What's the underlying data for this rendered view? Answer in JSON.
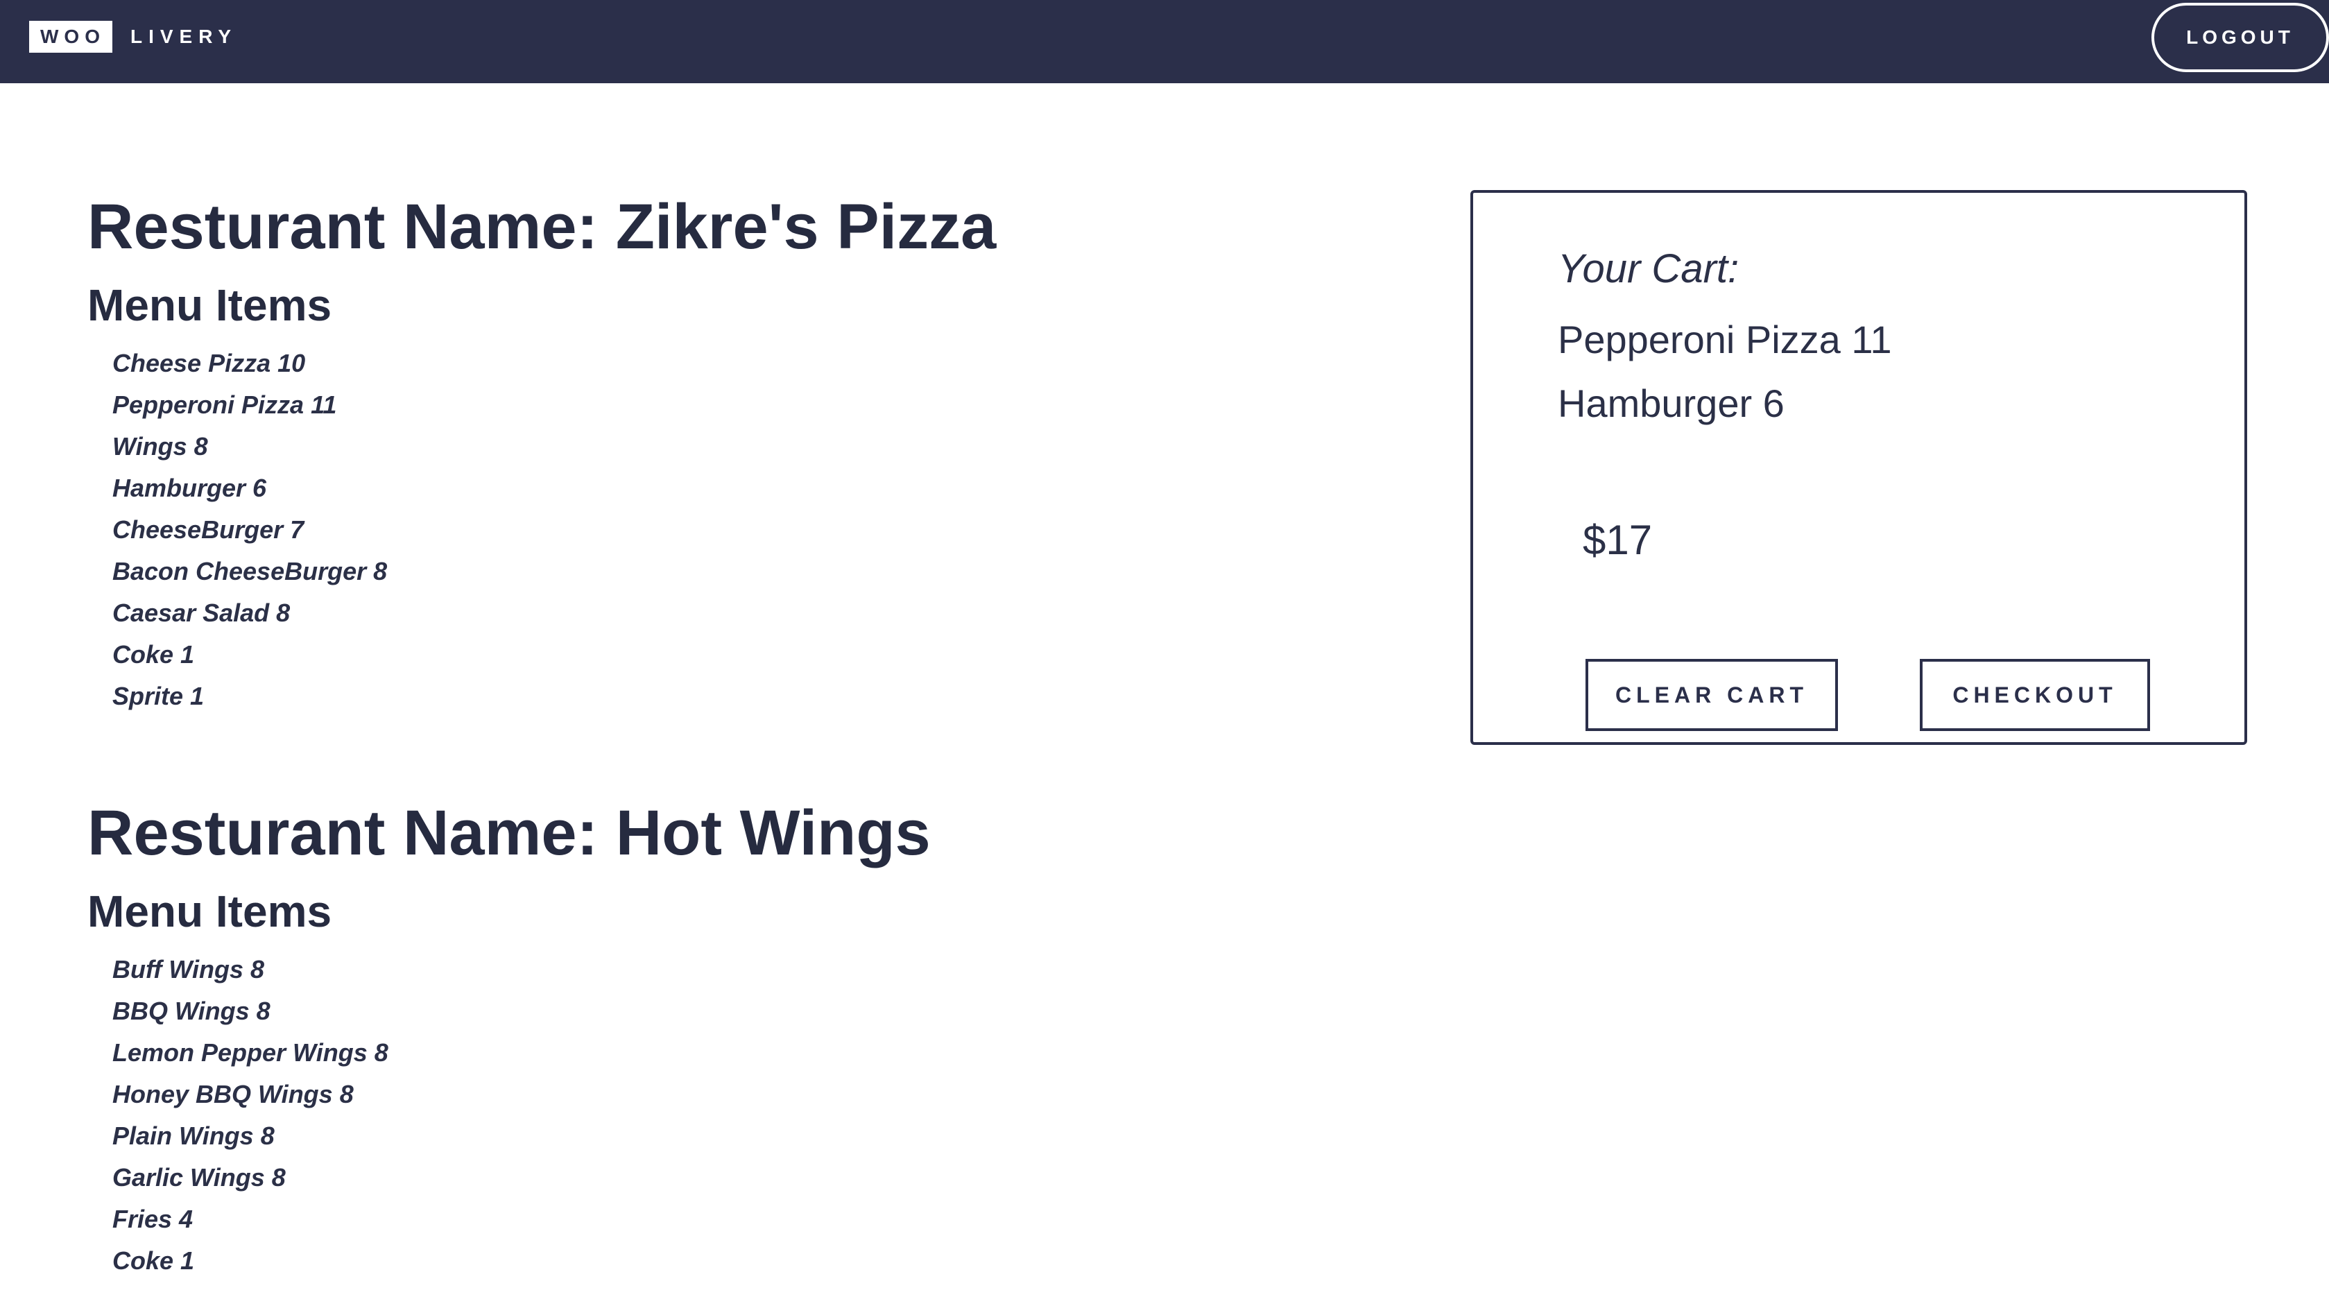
{
  "nav": {
    "brand_box": "WOO",
    "brand_text": "LIVERY",
    "logout_label": "LOGOUT"
  },
  "restaurants": [
    {
      "title": "Resturant Name: Zikre's Pizza",
      "menu_heading": "Menu Items",
      "items": [
        "Cheese Pizza 10",
        "Pepperoni Pizza 11",
        "Wings 8",
        "Hamburger 6",
        "CheeseBurger 7",
        "Bacon CheeseBurger 8",
        "Caesar Salad 8",
        "Coke 1",
        "Sprite 1"
      ]
    },
    {
      "title": "Resturant Name: Hot Wings",
      "menu_heading": "Menu Items",
      "items": [
        "Buff Wings 8",
        "BBQ Wings 8",
        "Lemon Pepper Wings 8",
        "Honey BBQ Wings 8",
        "Plain Wings 8",
        "Garlic Wings 8",
        "Fries 4",
        "Coke 1"
      ]
    }
  ],
  "cart": {
    "title": "Your Cart:",
    "items": [
      "Pepperoni Pizza 11",
      "Hamburger 6"
    ],
    "total": "$17",
    "clear_label": "CLEAR CART",
    "checkout_label": "CHECKOUT"
  },
  "colors": {
    "navbar": "#2b2f4a",
    "text": "#2b3047"
  }
}
